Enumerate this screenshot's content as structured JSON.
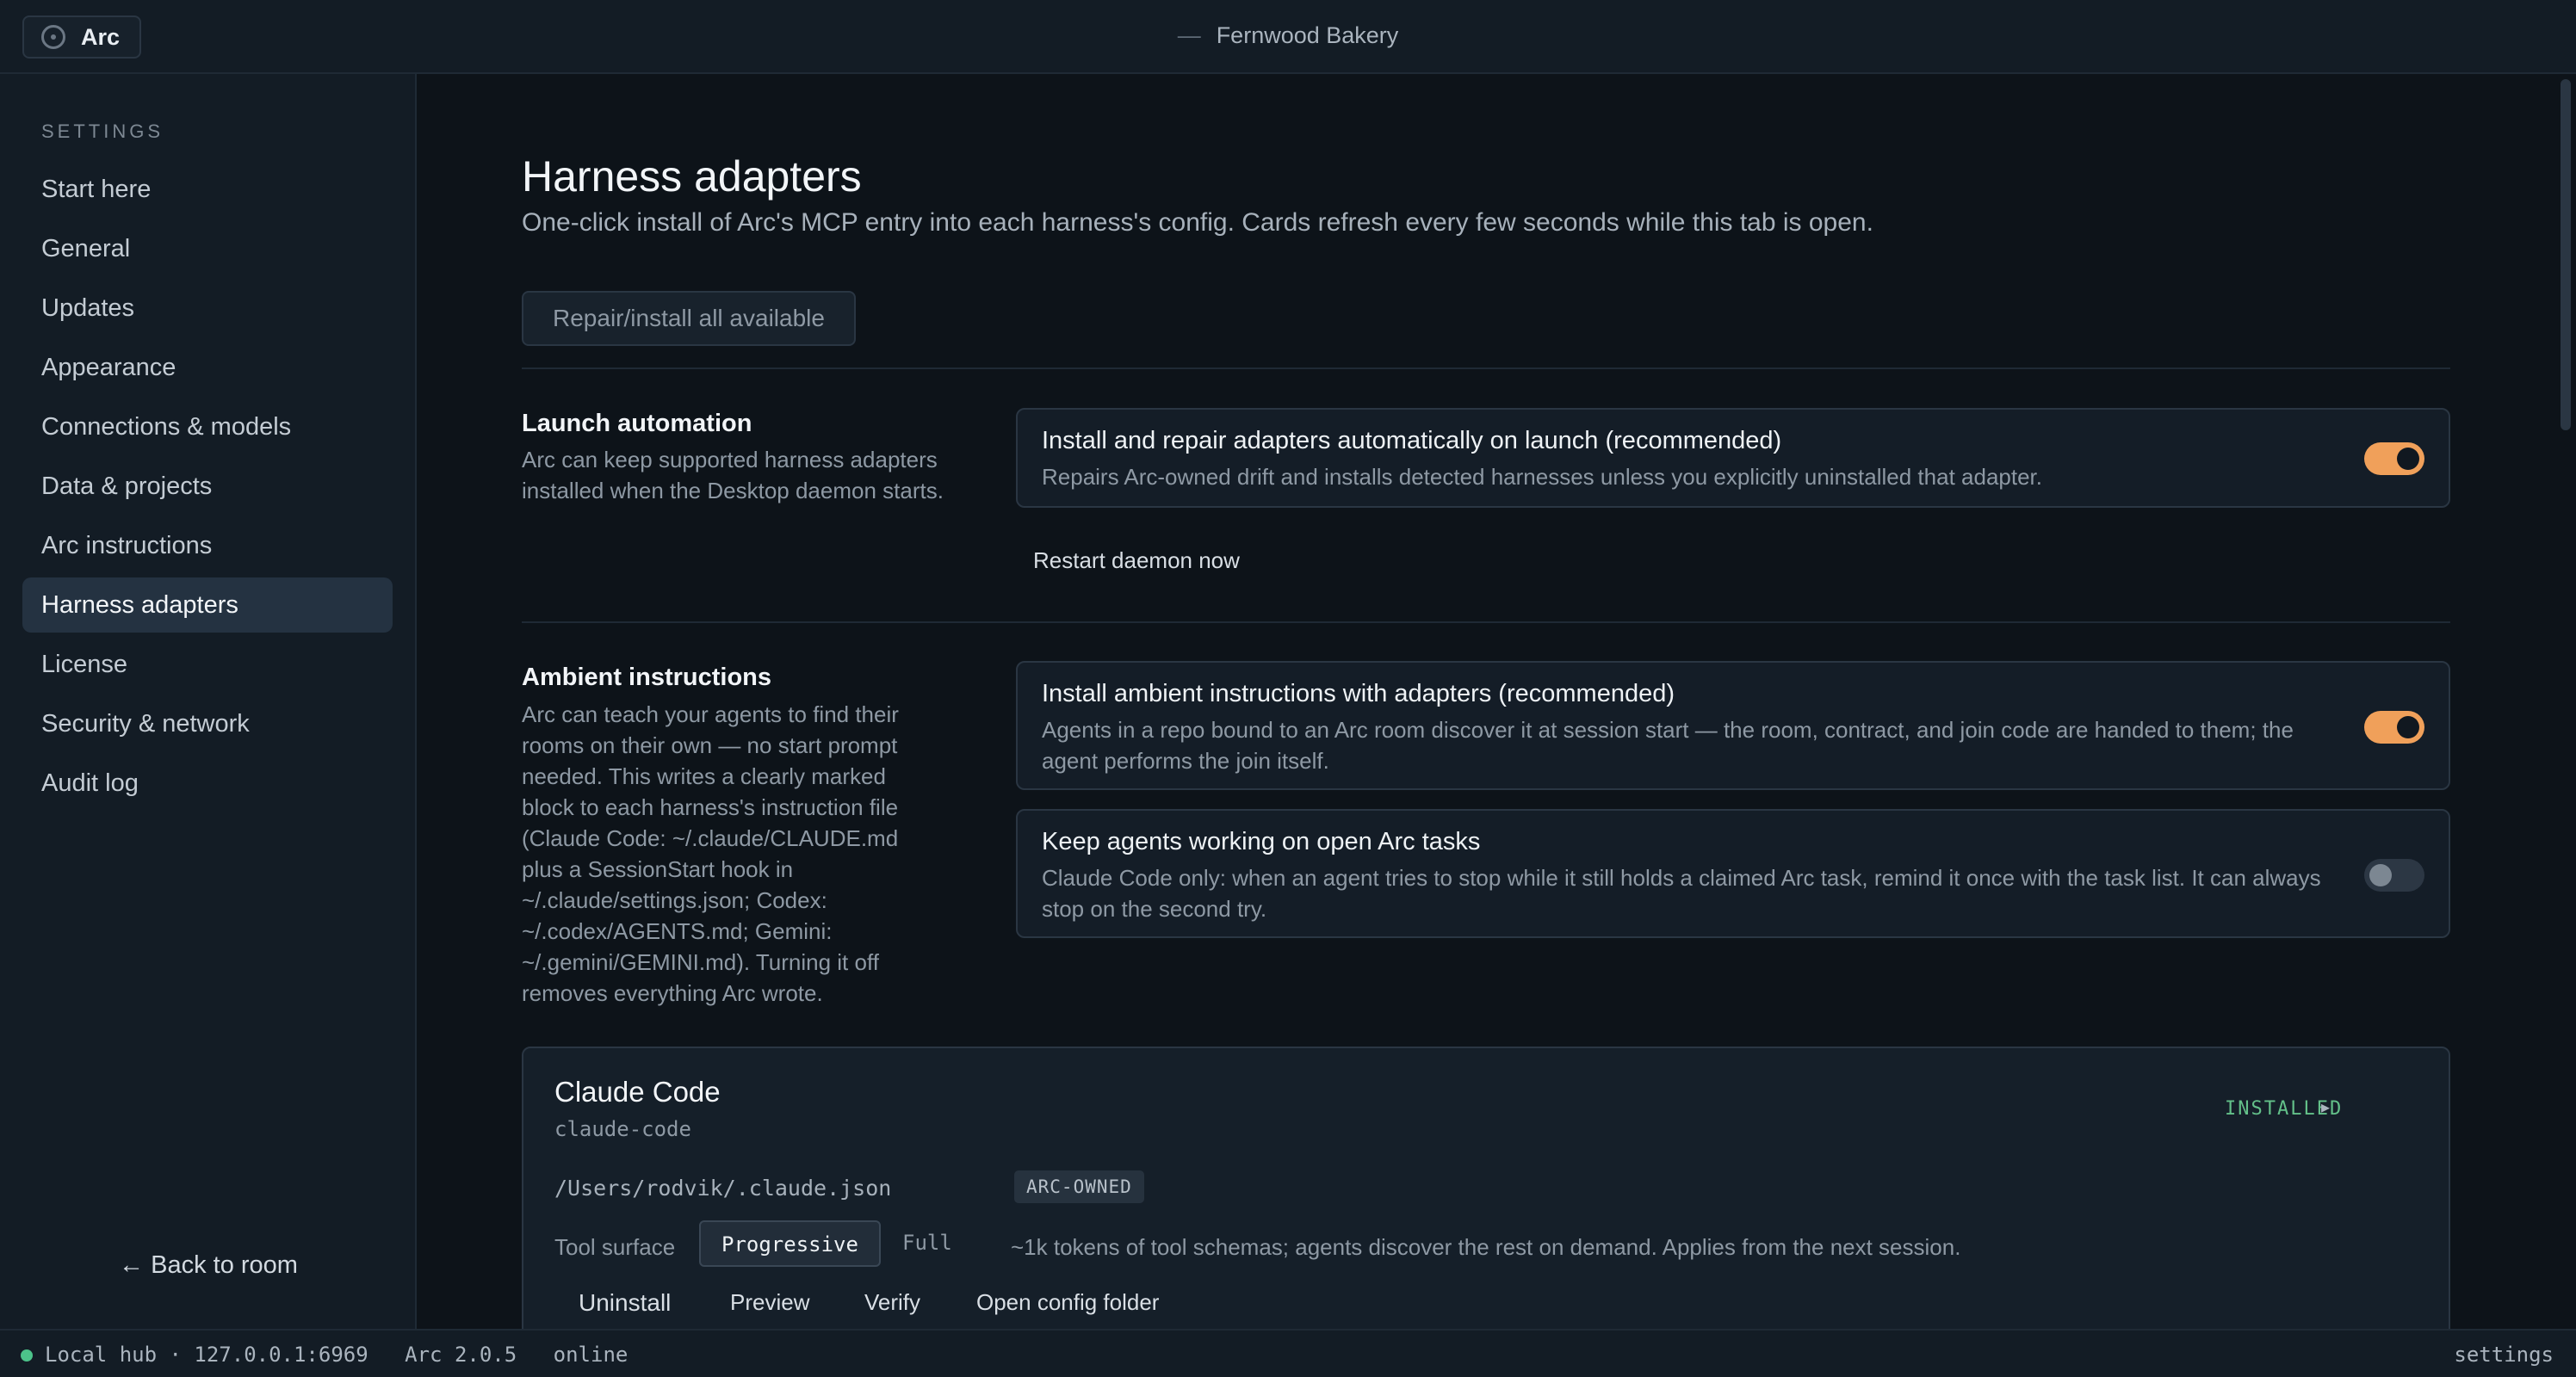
{
  "app": {
    "name": "Arc",
    "window_title": "Fernwood Bakery",
    "title_prefix": "—"
  },
  "sidebar": {
    "heading": "SETTINGS",
    "items": [
      {
        "label": "Start here"
      },
      {
        "label": "General"
      },
      {
        "label": "Updates"
      },
      {
        "label": "Appearance"
      },
      {
        "label": "Connections & models"
      },
      {
        "label": "Data & projects"
      },
      {
        "label": "Arc instructions"
      },
      {
        "label": "Harness adapters",
        "active": true
      },
      {
        "label": "License"
      },
      {
        "label": "Security & network"
      },
      {
        "label": "Audit log"
      }
    ],
    "back_label": "← Back to room"
  },
  "page": {
    "title": "Harness adapters",
    "subtitle": "One-click install of Arc's MCP entry into each harness's config. Cards refresh every few seconds while this tab is open.",
    "repair_all_label": "Repair/install all available"
  },
  "launch_automation": {
    "title": "Launch automation",
    "description": "Arc can keep supported harness adapters installed when the Desktop daemon starts.",
    "option": {
      "title": "Install and repair adapters automatically on launch (recommended)",
      "description": "Repairs Arc-owned drift and installs detected harnesses unless you explicitly uninstalled that adapter.",
      "enabled": true
    },
    "restart_label": "Restart daemon now"
  },
  "ambient_instructions": {
    "title": "Ambient instructions",
    "description": "Arc can teach your agents to find their rooms on their own — no start prompt needed. This writes a clearly marked block to each harness's instruction file (Claude Code: ~/.claude/CLAUDE.md plus a SessionStart hook in ~/.claude/settings.json; Codex: ~/.codex/AGENTS.md; Gemini: ~/.gemini/GEMINI.md). Turning it off removes everything Arc wrote.",
    "options": [
      {
        "title": "Install ambient instructions with adapters (recommended)",
        "description": "Agents in a repo bound to an Arc room discover it at session start — the room, contract, and join code are handed to them; the agent performs the join itself.",
        "enabled": true
      },
      {
        "title": "Keep agents working on open Arc tasks",
        "description": "Claude Code only: when an agent tries to stop while it still holds a claimed Arc task, remind it once with the task list. It can always stop on the second try.",
        "enabled": false
      }
    ]
  },
  "adapter": {
    "name": "Claude Code",
    "id": "claude-code",
    "status": "INSTALLED",
    "expand_glyph": "▸",
    "config_path": "/Users/rodvik/.claude.json",
    "owner_badge": "ARC-OWNED",
    "tool_surface_label": "Tool surface",
    "tool_surface_options": [
      "Progressive",
      "Full"
    ],
    "tool_surface_selected": "Progressive",
    "tool_surface_desc": "~1k tokens of tool schemas; agents discover the rest on demand. Applies from the next session.",
    "actions": [
      "Uninstall",
      "Preview",
      "Verify",
      "Open config folder"
    ]
  },
  "statusbar": {
    "hub": "Local hub · 127.0.0.1:6969",
    "version": "Arc 2.0.5",
    "state": "online",
    "right": "settings"
  },
  "colors": {
    "accent": "#f0a05a",
    "installed": "#63c089",
    "online": "#4cc38a"
  }
}
